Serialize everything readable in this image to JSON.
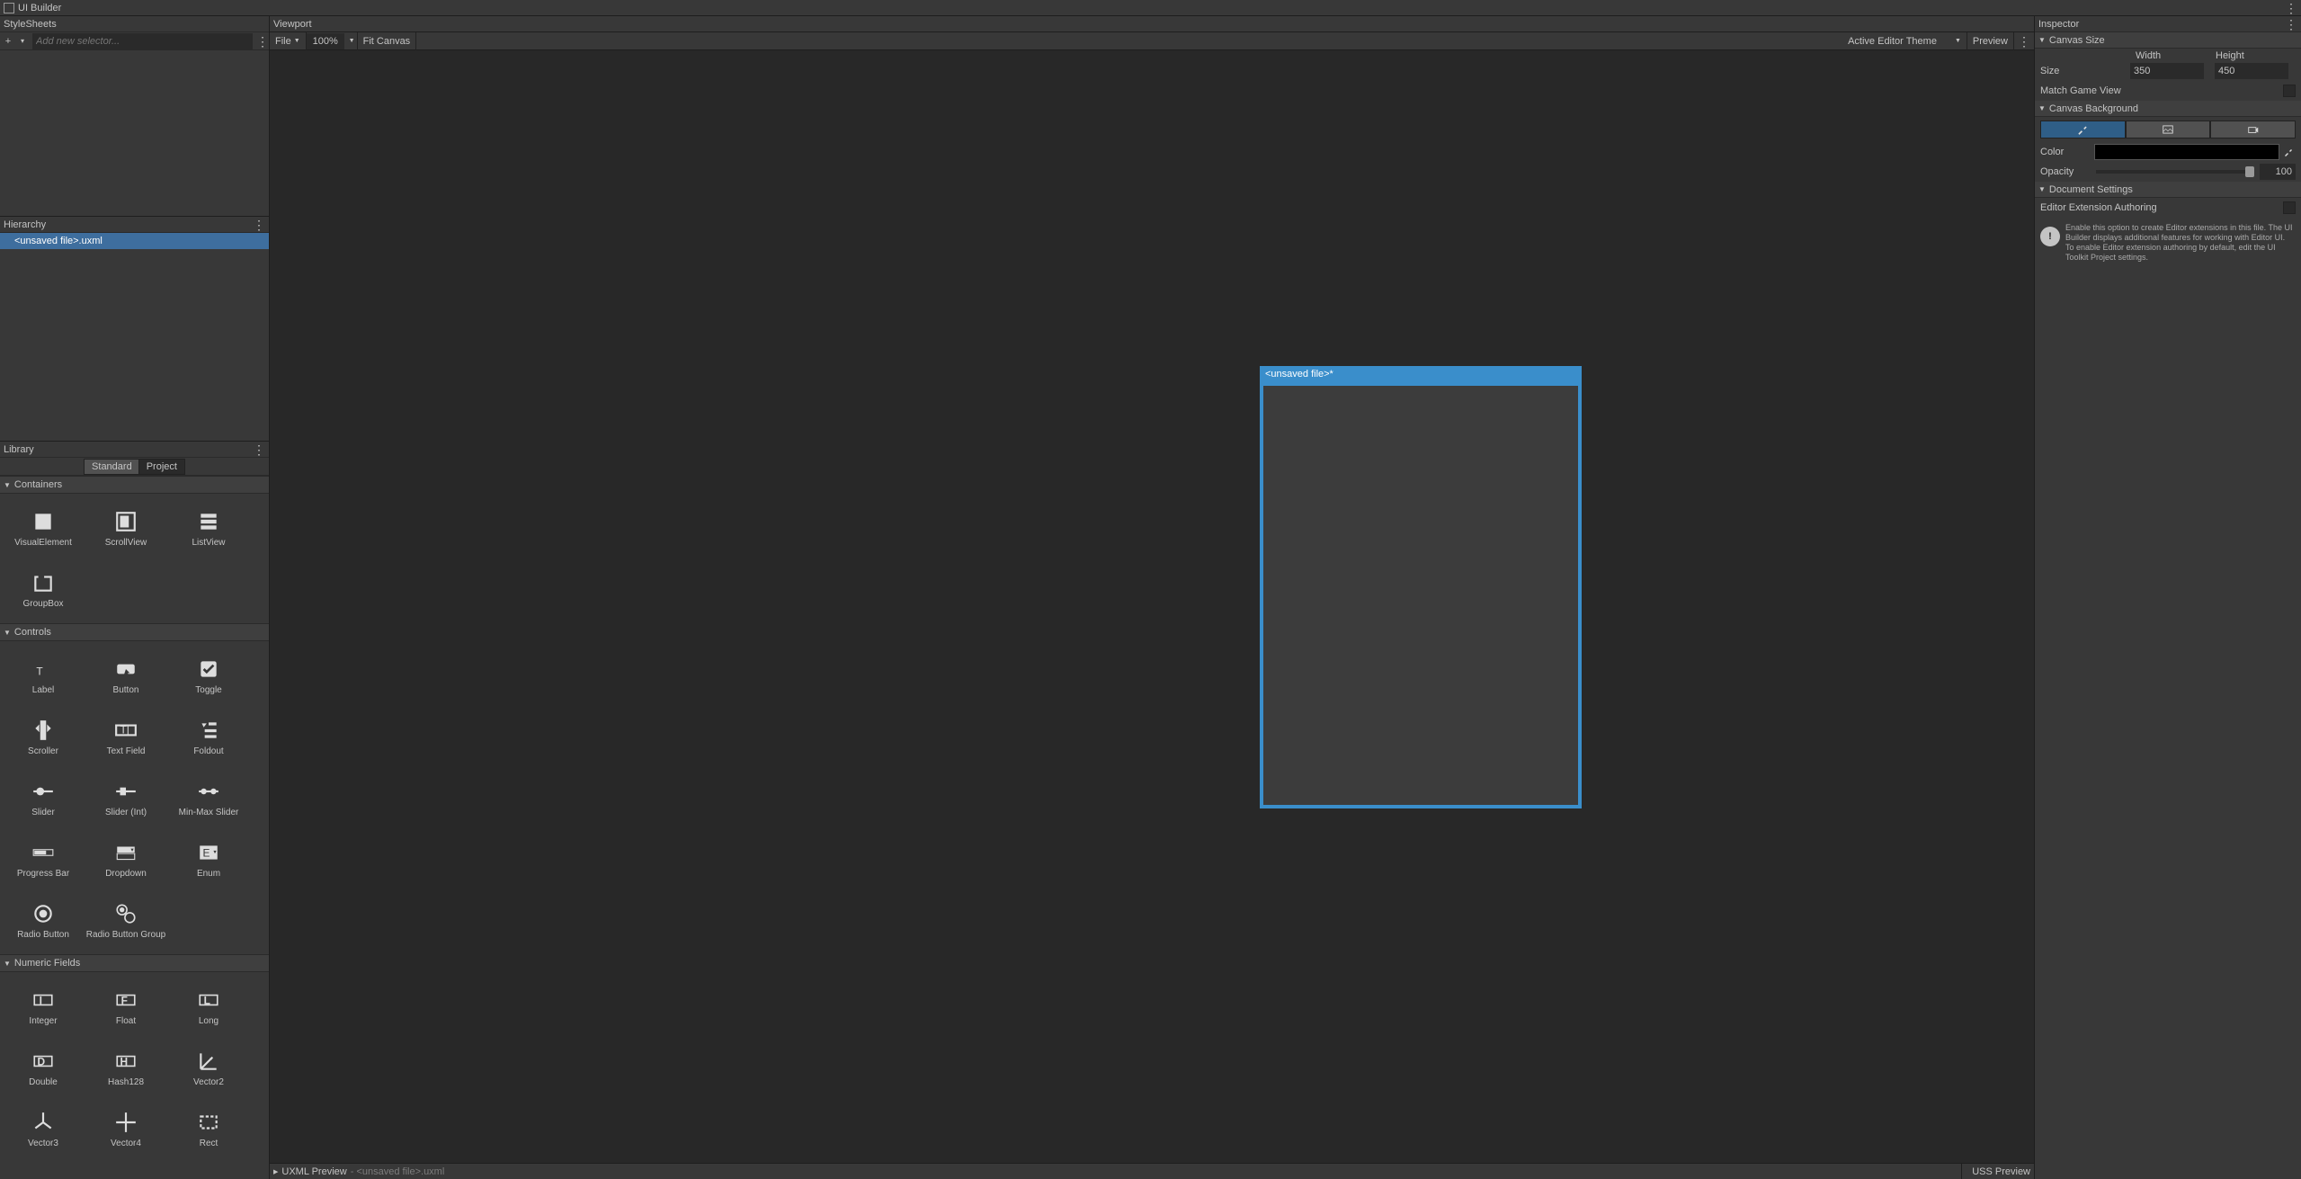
{
  "title": "UI Builder",
  "stylesheets": {
    "title": "StyleSheets",
    "placeholder": "Add new selector..."
  },
  "hierarchy": {
    "title": "Hierarchy",
    "root": "<unsaved file>.uxml"
  },
  "library": {
    "title": "Library",
    "tabs": {
      "standard": "Standard",
      "project": "Project"
    },
    "categories": {
      "containers": {
        "title": "Containers",
        "items": [
          "VisualElement",
          "ScrollView",
          "ListView",
          "GroupBox"
        ]
      },
      "controls": {
        "title": "Controls",
        "items": [
          "Label",
          "Button",
          "Toggle",
          "Scroller",
          "Text Field",
          "Foldout",
          "Slider",
          "Slider (Int)",
          "Min-Max Slider",
          "Progress Bar",
          "Dropdown",
          "Enum",
          "Radio Button",
          "Radio Button Group"
        ]
      },
      "numeric": {
        "title": "Numeric Fields",
        "items": [
          "Integer",
          "Float",
          "Long",
          "Double",
          "Hash128",
          "Vector2",
          "Vector3",
          "Vector4",
          "Rect"
        ]
      }
    }
  },
  "viewport": {
    "title": "Viewport",
    "file_menu": "File",
    "zoom": "100%",
    "fit": "Fit Canvas",
    "theme": "Active Editor Theme",
    "preview": "Preview",
    "canvas_title": "<unsaved file>*"
  },
  "bottom": {
    "uxml": "UXML Preview",
    "uxml_path": "- <unsaved file>.uxml",
    "uss": "USS Preview"
  },
  "inspector": {
    "title": "Inspector",
    "canvas_size": {
      "title": "Canvas Size",
      "size_label": "Size",
      "width_label": "Width",
      "height_label": "Height",
      "width": "350",
      "height": "450",
      "match": "Match Game View"
    },
    "canvas_bg": {
      "title": "Canvas Background",
      "color_label": "Color",
      "opacity_label": "Opacity",
      "opacity": "100"
    },
    "doc_settings": {
      "title": "Document Settings"
    },
    "ext_auth": {
      "title": "Editor Extension Authoring",
      "info": "Enable this option to create Editor extensions in this file. The UI Builder displays additional features for working with Editor UI.\nTo enable Editor extension authoring by default, edit the UI Toolkit Project settings."
    }
  }
}
